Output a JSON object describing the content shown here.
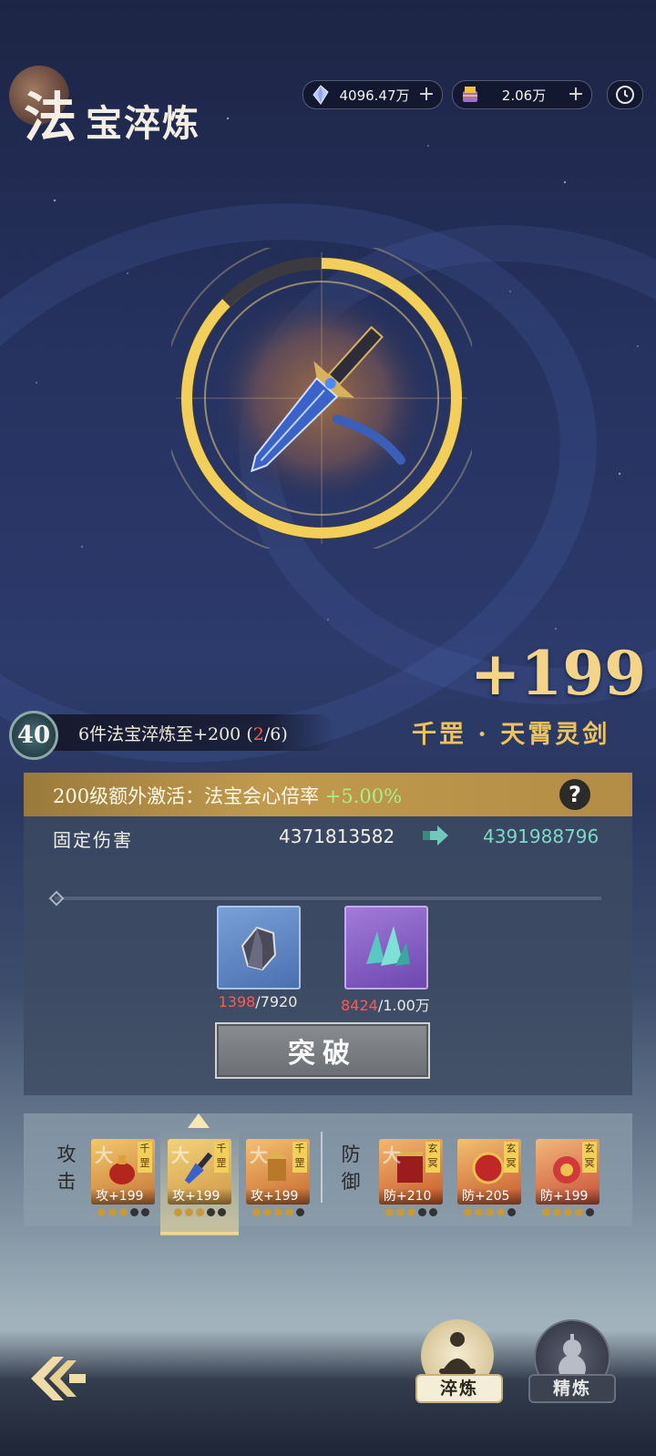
{
  "header": {
    "title_big": "法",
    "title_small": "宝淬炼"
  },
  "currencies": [
    {
      "icon": "crystal-icon",
      "value": "4096.47万"
    },
    {
      "icon": "scroll-chest-icon",
      "value": "2.06万"
    }
  ],
  "artifact": {
    "level": "+199",
    "name": "千罡 · 天霄灵剑"
  },
  "set_bonus": {
    "badge": "40",
    "text_prefix": "6件法宝淬炼至+200 (",
    "current": "2",
    "text_suffix": "/6)"
  },
  "extra_activation": {
    "text": "200级额外激活：法宝会心倍率",
    "value": "+5.00%"
  },
  "stat": {
    "label": "固定伤害",
    "old_value": "4371813582",
    "new_value": "4391988796"
  },
  "materials": [
    {
      "icon": "gray-ore-icon",
      "owned": "1398",
      "required": "/7920"
    },
    {
      "icon": "teal-crystal-icon",
      "owned": "8424",
      "required": "/1.00万"
    }
  ],
  "breakthrough_button": "突破",
  "equipment": {
    "attack_label": [
      "攻",
      "击"
    ],
    "defense_label": [
      "防",
      "御"
    ],
    "attack_items": [
      {
        "big": "大",
        "tag": "千罡",
        "level": "攻+199",
        "dots_on": 3,
        "dots_total": 5
      },
      {
        "big": "大",
        "tag": "千罡",
        "level": "攻+199",
        "dots_on": 3,
        "dots_total": 5
      },
      {
        "big": "大",
        "tag": "千罡",
        "level": "攻+199",
        "dots_on": 4,
        "dots_total": 5
      }
    ],
    "defense_items": [
      {
        "big": "大",
        "tag": "玄冥",
        "level": "防+210",
        "dots_on": 3,
        "dots_total": 5
      },
      {
        "big": "",
        "tag": "玄冥",
        "level": "防+205",
        "dots_on": 4,
        "dots_total": 5
      },
      {
        "big": "",
        "tag": "玄冥",
        "level": "防+199",
        "dots_on": 4,
        "dots_total": 5
      }
    ],
    "selected_index": 1
  },
  "bottom_nav": {
    "tab_temper": "淬炼",
    "tab_refine": "精炼"
  },
  "colors": {
    "gold": "#f0c25a",
    "accent_green": "#a6f08a",
    "accent_teal": "#7fd7c8",
    "warning_red": "#ff5a4e"
  }
}
